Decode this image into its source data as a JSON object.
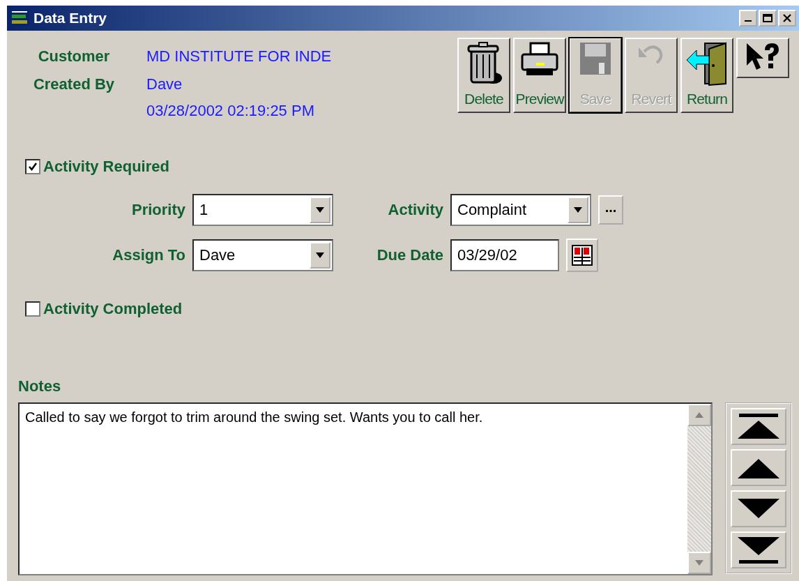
{
  "window": {
    "title": "Data Entry"
  },
  "header": {
    "fields": [
      {
        "label": "Customer",
        "values": [
          "MD INSTITUTE FOR INDE"
        ]
      },
      {
        "label": "Created By",
        "values": [
          "Dave",
          "03/28/2002 02:19:25 PM"
        ]
      }
    ]
  },
  "toolbar": [
    {
      "kind": "delete",
      "label": "Delete",
      "disabled": false,
      "focused": false
    },
    {
      "kind": "preview",
      "label": "Preview",
      "disabled": false,
      "focused": false
    },
    {
      "kind": "save",
      "label": "Save",
      "disabled": true,
      "focused": true
    },
    {
      "kind": "revert",
      "label": "Revert",
      "disabled": true,
      "focused": false
    },
    {
      "kind": "return",
      "label": "Return",
      "disabled": false,
      "focused": false
    },
    {
      "kind": "help",
      "disabled": false,
      "focused": false
    }
  ],
  "activity_required": {
    "label": "Activity Required",
    "checked": true
  },
  "form_rows": [
    [
      {
        "kind": "combo",
        "label": "Priority",
        "value": "1"
      },
      {
        "kind": "combo",
        "label": "Activity",
        "value": "Complaint",
        "button_label": "..."
      }
    ],
    [
      {
        "kind": "combo",
        "label": "Assign To",
        "value": "Dave"
      },
      {
        "kind": "date",
        "label": "Due Date",
        "value": "03/29/02"
      }
    ]
  ],
  "activity_completed": {
    "label": "Activity Completed",
    "checked": false
  },
  "notes": {
    "label": "Notes",
    "value": "Called to say we forgot to trim around the swing set. Wants you to call her."
  }
}
